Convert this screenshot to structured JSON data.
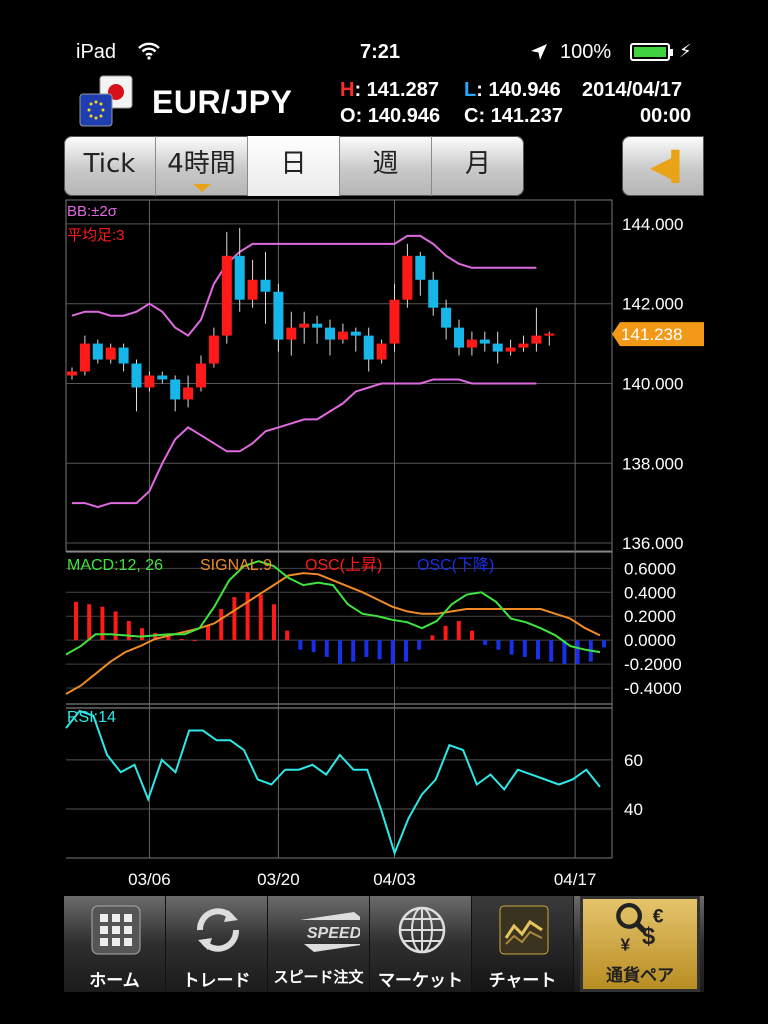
{
  "status": {
    "device": "iPad",
    "time": "7:21",
    "battery": "100%"
  },
  "header": {
    "pair": "EUR/JPY",
    "h_label": "H",
    "h_value": "141.287",
    "l_label": "L",
    "l_value": "140.946",
    "o_label": "O",
    "o_value": "140.946",
    "c_label": "C",
    "c_value": "141.237",
    "date": "2014/04/17",
    "time": "00:00"
  },
  "tabs": [
    {
      "label": "Tick",
      "active": false
    },
    {
      "label": "4時間",
      "active": false
    },
    {
      "label": "日",
      "active": true
    },
    {
      "label": "週",
      "active": false
    },
    {
      "label": "月",
      "active": false
    }
  ],
  "colors": {
    "up": "#ff1a1a",
    "down": "#16b7e8",
    "bb": "#e06ae0",
    "macd": "#3ee53e",
    "signal": "#f08a24",
    "osc_up": "#ff1a1a",
    "osc_down": "#1a2fe8",
    "rsi": "#2ee8e8",
    "price_tag": "#f29a18"
  },
  "chart_data": [
    {
      "type": "candlestick",
      "legend": [
        "BB:±2σ",
        "平均足:3"
      ],
      "y_ticks": [
        "144.000",
        "142.000",
        "140.000",
        "138.000",
        "136.000"
      ],
      "ylim": [
        135.8,
        144.6
      ],
      "current_price": "141.238",
      "x_ticks": [
        "03/06",
        "03/20",
        "04/03",
        "04/17"
      ],
      "x_tick_index": [
        6,
        16,
        25,
        39
      ],
      "candles": [
        [
          140.2,
          140.3,
          140.1,
          140.4
        ],
        [
          140.3,
          141.0,
          140.2,
          141.2
        ],
        [
          141.0,
          140.6,
          140.5,
          141.1
        ],
        [
          140.6,
          140.9,
          140.5,
          141.0
        ],
        [
          140.9,
          140.5,
          140.3,
          141.0
        ],
        [
          140.5,
          139.9,
          139.3,
          140.6
        ],
        [
          139.9,
          140.2,
          139.8,
          140.3
        ],
        [
          140.2,
          140.1,
          140.0,
          140.3
        ],
        [
          140.1,
          139.6,
          139.3,
          140.2
        ],
        [
          139.6,
          139.9,
          139.4,
          140.2
        ],
        [
          139.9,
          140.5,
          139.8,
          140.7
        ],
        [
          140.5,
          141.2,
          140.4,
          141.4
        ],
        [
          141.2,
          143.2,
          141.0,
          143.8
        ],
        [
          143.2,
          142.1,
          141.8,
          143.9
        ],
        [
          142.1,
          142.6,
          141.9,
          143.1
        ],
        [
          142.6,
          142.3,
          141.5,
          143.3
        ],
        [
          142.3,
          141.1,
          140.8,
          142.5
        ],
        [
          141.1,
          141.4,
          140.7,
          141.8
        ],
        [
          141.4,
          141.5,
          141.0,
          141.8
        ],
        [
          141.5,
          141.4,
          141.0,
          141.7
        ],
        [
          141.4,
          141.1,
          140.7,
          141.6
        ],
        [
          141.1,
          141.3,
          141.0,
          141.5
        ],
        [
          141.3,
          141.2,
          140.8,
          141.4
        ],
        [
          141.2,
          140.6,
          140.3,
          141.4
        ],
        [
          140.6,
          141.0,
          140.5,
          141.1
        ],
        [
          141.0,
          142.1,
          140.8,
          142.5
        ],
        [
          142.1,
          143.2,
          141.9,
          143.5
        ],
        [
          143.2,
          142.6,
          142.2,
          143.3
        ],
        [
          142.6,
          141.9,
          141.7,
          142.8
        ],
        [
          141.9,
          141.4,
          141.1,
          142.1
        ],
        [
          141.4,
          140.9,
          140.7,
          141.6
        ],
        [
          140.9,
          141.1,
          140.7,
          141.3
        ],
        [
          141.1,
          141.0,
          140.8,
          141.3
        ],
        [
          141.0,
          140.8,
          140.5,
          141.3
        ],
        [
          140.8,
          140.9,
          140.7,
          141.1
        ],
        [
          140.9,
          141.0,
          140.8,
          141.2
        ],
        [
          141.0,
          141.2,
          140.8,
          141.9
        ],
        [
          141.2,
          141.25,
          140.95,
          141.3
        ]
      ],
      "bb_upper": [
        141.7,
        141.8,
        141.8,
        141.7,
        141.7,
        141.8,
        142.0,
        141.8,
        141.4,
        141.2,
        141.6,
        142.5,
        143.0,
        143.3,
        143.5,
        143.5,
        143.5,
        143.5,
        143.5,
        143.5,
        143.5,
        143.5,
        143.5,
        143.5,
        143.5,
        143.5,
        143.7,
        143.7,
        143.5,
        143.2,
        143.0,
        142.9,
        142.9,
        142.9,
        142.9,
        142.9,
        142.9
      ],
      "bb_lower": [
        137.0,
        137.0,
        136.9,
        137.0,
        137.0,
        137.0,
        137.3,
        138.0,
        138.6,
        138.9,
        138.7,
        138.5,
        138.3,
        138.3,
        138.5,
        138.8,
        138.9,
        139.0,
        139.1,
        139.1,
        139.3,
        139.5,
        139.8,
        139.9,
        140.0,
        140.0,
        140.0,
        140.0,
        140.1,
        140.1,
        140.1,
        140.0,
        140.0,
        140.0,
        140.0,
        140.0,
        140.0
      ]
    },
    {
      "type": "line_bar",
      "legend": [
        "MACD:12, 26",
        "SIGNAL:9",
        "OSC(上昇)",
        "OSC(下降)"
      ],
      "y_ticks": [
        "0.6000",
        "0.4000",
        "0.2000",
        "0.0000",
        "-0.2000",
        "-0.4000"
      ],
      "ylim": [
        -0.5,
        0.72
      ],
      "macd": [
        -0.12,
        -0.05,
        0.05,
        0.05,
        0.04,
        0.03,
        0.04,
        0.05,
        0.05,
        0.1,
        0.28,
        0.5,
        0.62,
        0.66,
        0.62,
        0.52,
        0.46,
        0.48,
        0.46,
        0.3,
        0.22,
        0.2,
        0.17,
        0.15,
        0.1,
        0.16,
        0.3,
        0.38,
        0.4,
        0.32,
        0.18,
        0.15,
        0.1,
        0.04,
        -0.05,
        -0.08,
        -0.1
      ],
      "signal": [
        -0.45,
        -0.38,
        -0.28,
        -0.18,
        -0.1,
        -0.05,
        0.01,
        0.04,
        0.07,
        0.1,
        0.14,
        0.22,
        0.3,
        0.38,
        0.46,
        0.54,
        0.56,
        0.55,
        0.5,
        0.45,
        0.4,
        0.34,
        0.28,
        0.24,
        0.22,
        0.22,
        0.24,
        0.26,
        0.26,
        0.26,
        0.26,
        0.26,
        0.26,
        0.22,
        0.18,
        0.1,
        0.04
      ],
      "osc": [
        0.32,
        0.3,
        0.28,
        0.24,
        0.16,
        0.1,
        0.06,
        0.03,
        0.01,
        0.0,
        0.12,
        0.26,
        0.36,
        0.4,
        0.38,
        0.3,
        0.08,
        -0.08,
        -0.1,
        -0.14,
        -0.2,
        -0.18,
        -0.14,
        -0.16,
        -0.2,
        -0.18,
        -0.08,
        0.04,
        0.12,
        0.16,
        0.08,
        -0.04,
        -0.08,
        -0.12,
        -0.14,
        -0.16,
        -0.18,
        -0.2,
        -0.2,
        -0.18,
        -0.06
      ]
    },
    {
      "type": "line",
      "legend": [
        "RSI:14"
      ],
      "y_ticks": [
        "60",
        "40"
      ],
      "ylim": [
        20,
        82
      ],
      "rsi": [
        73,
        80,
        78,
        62,
        55,
        58,
        44,
        60,
        55,
        72,
        72,
        68,
        68,
        64,
        52,
        50,
        56,
        56,
        58,
        54,
        62,
        56,
        56,
        40,
        22,
        36,
        46,
        52,
        66,
        64,
        50,
        54,
        48,
        56,
        54,
        52,
        50,
        52,
        56,
        49
      ]
    }
  ],
  "toolbar": [
    {
      "label": "ホーム",
      "icon": "home-grid-icon",
      "active": false
    },
    {
      "label": "トレード",
      "icon": "trade-arrows-icon",
      "active": false
    },
    {
      "label": "スピード注文",
      "icon": "speed-order-icon",
      "active": false
    },
    {
      "label": "マーケット",
      "icon": "globe-icon",
      "active": false
    },
    {
      "label": "チャート",
      "icon": "chart-icon",
      "active": true
    },
    {
      "label": "通貨ペア",
      "icon": "currency-pairs-icon",
      "active": false
    }
  ],
  "toolbar_speed_text": "SPEED"
}
